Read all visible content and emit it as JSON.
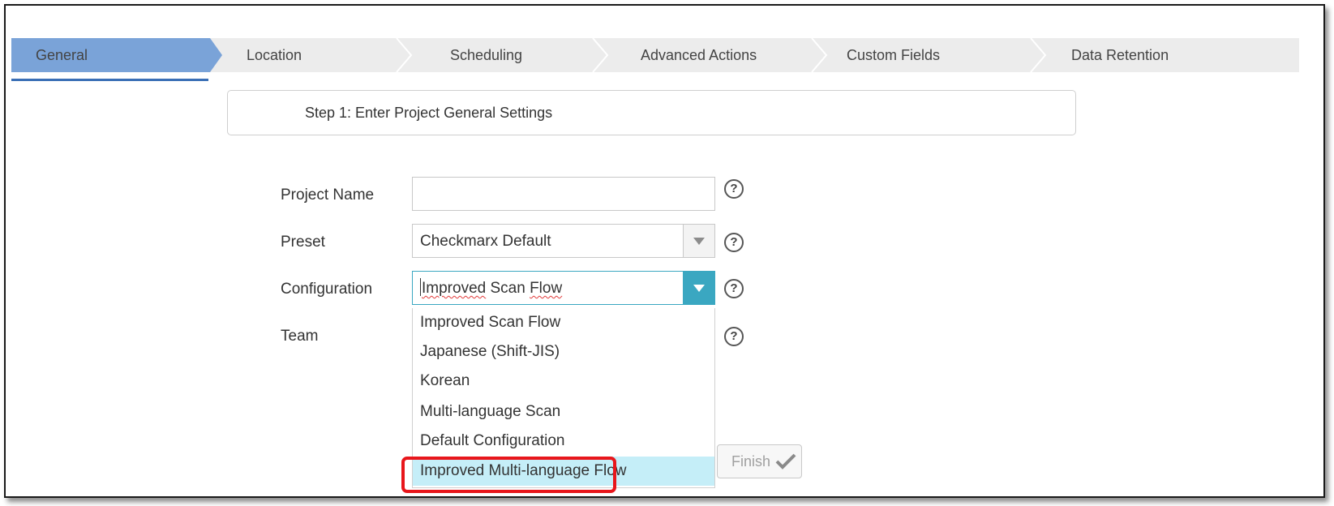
{
  "wizard": {
    "steps": [
      {
        "label": "General",
        "active": true
      },
      {
        "label": "Location",
        "active": false
      },
      {
        "label": "Scheduling",
        "active": false
      },
      {
        "label": "Advanced Actions",
        "active": false
      },
      {
        "label": "Custom Fields",
        "active": false
      },
      {
        "label": "Data Retention",
        "active": false
      }
    ],
    "step_title": "Step 1: Enter Project General Settings"
  },
  "form": {
    "project_name": {
      "label": "Project Name",
      "value": ""
    },
    "preset": {
      "label": "Preset",
      "value": "Checkmarx Default"
    },
    "configuration": {
      "label": "Configuration",
      "value_part1": "Improved",
      "value_part2": " Scan ",
      "value_part3": "Flow",
      "options": [
        "Improved Scan Flow",
        "Japanese (Shift-JIS)",
        "Korean",
        "Multi-language Scan",
        "Default Configuration",
        "Improved Multi-language Flow"
      ],
      "highlighted_index": 5
    },
    "team": {
      "label": "Team"
    },
    "help_glyph": "?"
  },
  "actions": {
    "finish_label": "Finish"
  },
  "colors": {
    "active_step": "#7aa3d8",
    "accent": "#3aa7c1",
    "highlight": "#c5eef8",
    "annotation": "#e8161b"
  }
}
